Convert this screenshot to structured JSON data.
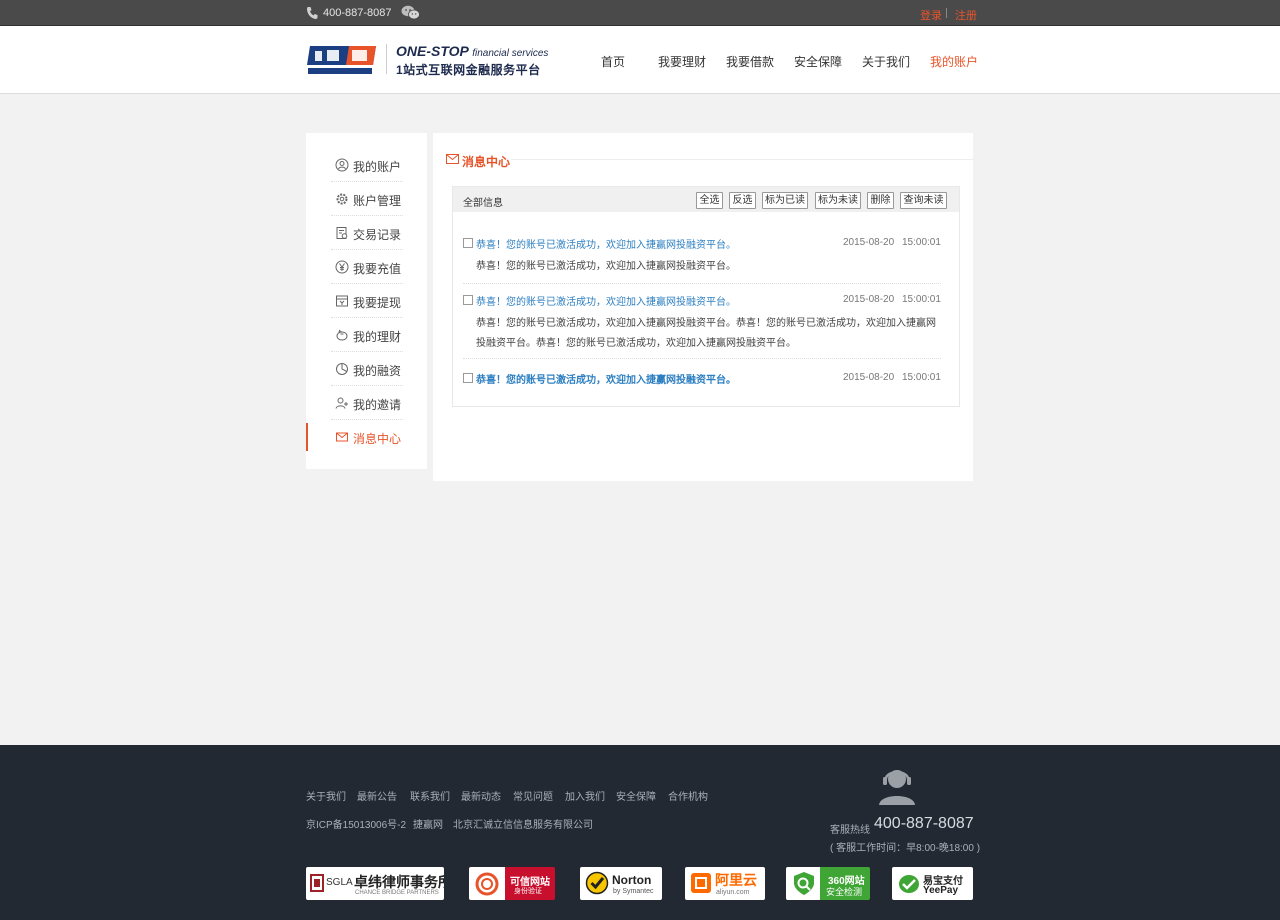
{
  "topbar": {
    "phone": "400-887-8087",
    "login": "登录",
    "register": "注册"
  },
  "header": {
    "slogan_en_main": "ONE-STOP",
    "slogan_en_sub": "financial services",
    "slogan_cn": "1站式互联网金融服务平台",
    "nav": [
      "首页",
      "我要理财",
      "我要借款",
      "安全保障",
      "关于我们",
      "我的账户"
    ],
    "active_nav": "我的账户",
    "accent_color": "#e8542a"
  },
  "sidebar": {
    "items": [
      {
        "label": "我的账户",
        "icon": "user-circle-icon"
      },
      {
        "label": "账户管理",
        "icon": "gear-icon"
      },
      {
        "label": "交易记录",
        "icon": "record-icon"
      },
      {
        "label": "我要充值",
        "icon": "yuan-icon"
      },
      {
        "label": "我要提现",
        "icon": "withdraw-icon"
      },
      {
        "label": "我的理财",
        "icon": "piggy-icon"
      },
      {
        "label": "我的融资",
        "icon": "pie-icon"
      },
      {
        "label": "我的邀请",
        "icon": "invite-icon"
      },
      {
        "label": "消息中心",
        "icon": "mail-icon"
      }
    ],
    "active": "消息中心"
  },
  "main": {
    "title": "消息中心",
    "toolbar": {
      "all_label": "全部信息",
      "buttons": [
        "全选",
        "反选",
        "标为已读",
        "标为未读",
        "删除",
        "查询未读"
      ]
    },
    "messages": [
      {
        "subject": "恭喜！您的账号已激活成功，欢迎加入捷赢网投融资平台。",
        "date": "2015-08-20",
        "time": "15:00:01",
        "body": "恭喜！您的账号已激活成功，欢迎加入捷赢网投融资平台。"
      },
      {
        "subject": "恭喜！您的账号已激活成功，欢迎加入捷赢网投融资平台。",
        "date": "2015-08-20",
        "time": "15:00:01",
        "body": "恭喜！您的账号已激活成功，欢迎加入捷赢网投融资平台。恭喜！您的账号已激活成功，欢迎加入捷赢网投融资平台。恭喜！您的账号已激活成功，欢迎加入捷赢网投融资平台。"
      },
      {
        "subject": "恭喜！您的账号已激活成功，欢迎加入捷赢网投融资平台。",
        "date": "2015-08-20",
        "time": "15:00:01",
        "body": ""
      }
    ]
  },
  "footer": {
    "links": [
      "关于我们",
      "最新公告",
      "联系我们",
      "最新动态",
      "常见问题",
      "加入我们",
      "安全保障",
      "合作机构"
    ],
    "copyright": [
      "京ICP备15013006号-2",
      "捷赢网",
      "北京汇诚立信信息服务有限公司"
    ],
    "hotline_label": "客服热线",
    "hotline": "400-887-8087",
    "hours": "( 客服工作时间：早8:00-晚18:00 )",
    "badges": {
      "sgla_a": "SGLA",
      "sgla_b": "卓纬律师事务所",
      "sgla_c": "CHANCE BRIDGE PARTNERS",
      "credible_a": "可信网站",
      "credible_b": "身份验证",
      "norton_a": "Norton",
      "norton_b": "by Symantec",
      "aliyun_a": "阿里云",
      "aliyun_b": "aliyun.com",
      "s360_a": "360网站",
      "s360_b": "安全检测",
      "yeepay_a": "易宝支付",
      "yeepay_b": "YeePay"
    }
  }
}
